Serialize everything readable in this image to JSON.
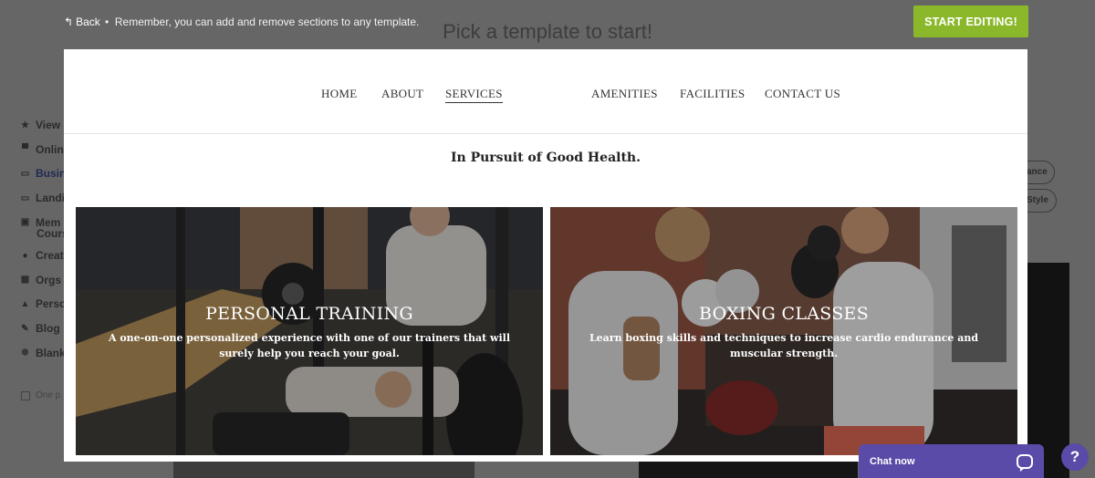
{
  "topbar": {
    "back_label": "Back",
    "separator": "•",
    "hint": "Remember, you can add and remove sections to any template.",
    "page_title": "Pick a template to start!",
    "start_button": "START EDITING!"
  },
  "background_sidebar": {
    "items": [
      {
        "icon": "star-icon",
        "label": "View"
      },
      {
        "icon": "cart-icon",
        "label": "Onlin"
      },
      {
        "icon": "briefcase-icon",
        "label": "Busin"
      },
      {
        "icon": "window-icon",
        "label": "Landi"
      },
      {
        "icon": "id-card-icon",
        "label": "Mem"
      },
      {
        "icon": "palette-icon",
        "label": "Creat"
      },
      {
        "icon": "building-icon",
        "label": "Orgs -"
      },
      {
        "icon": "person-icon",
        "label": "Perso"
      },
      {
        "icon": "pen-icon",
        "label": "Blog"
      },
      {
        "icon": "plus-circle-icon",
        "label": "Blank"
      }
    ],
    "sub_label": "Cours",
    "checkbox_label": "One p"
  },
  "background_pills": [
    "ance",
    "Style"
  ],
  "preview": {
    "nav": [
      "HOME",
      "ABOUT",
      "SERVICES",
      "AMENITIES",
      "FACILITIES",
      "CONTACT US"
    ],
    "active_nav": "SERVICES",
    "headline": "In Pursuit of Good Health.",
    "cards": [
      {
        "title": "PERSONAL TRAINING",
        "description": "A one-on-one personalized experience with one of our trainers that will surely help you reach your goal."
      },
      {
        "title": "BOXING CLASSES",
        "description": "Learn boxing skills and techniques to increase cardio endurance and muscular strength."
      }
    ]
  },
  "chat_widget": {
    "label": "Chat now",
    "help": "?"
  },
  "colors": {
    "accent_green": "#8ab82a",
    "chat_purple": "#5a4ba8",
    "overlay": "#666666"
  }
}
